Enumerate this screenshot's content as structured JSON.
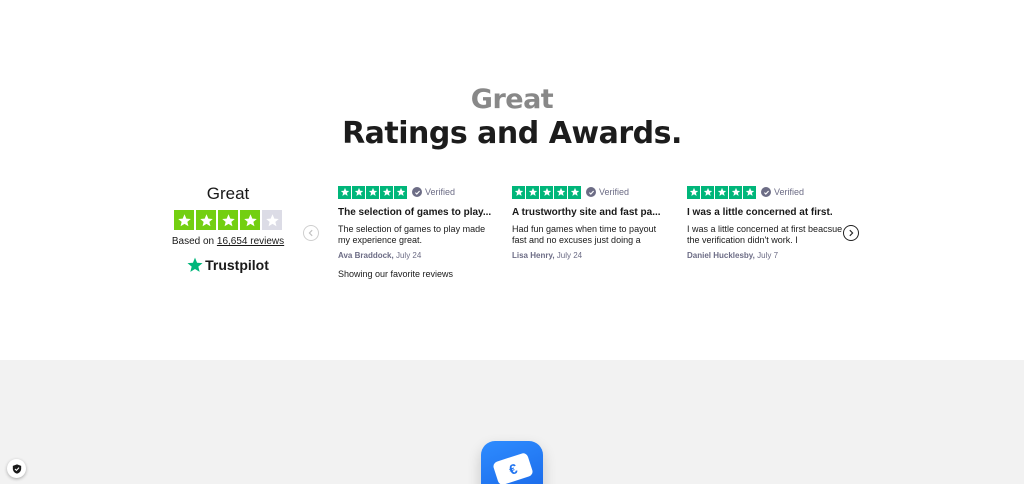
{
  "heading": {
    "sub": "Great",
    "main": "Ratings and Awards."
  },
  "trustpilot": {
    "rating_word": "Great",
    "stars_filled": 4,
    "stars_total": 5,
    "based_on_prefix": "Based on",
    "reviews_link": "16,654 reviews",
    "brand": "Trustpilot",
    "star_color": "#73cf11",
    "logo_star_color": "#00b67a"
  },
  "reviews": [
    {
      "verified_label": "Verified",
      "title": "The selection of games to play...",
      "body": "The selection of games to play made my experience great.",
      "author": "Ava Braddock,",
      "date": "July 24"
    },
    {
      "verified_label": "Verified",
      "title": "A trustworthy site and fast pa...",
      "body": "Had fun games when time to payout fast and no excuses just doing a",
      "author": "Lisa Henry,",
      "date": "July 24"
    },
    {
      "verified_label": "Verified",
      "title": "I was a little concerned at first.",
      "body": "I was a little concerned at first beacsue the verification didn't work. I",
      "author": "Daniel Hucklesby,",
      "date": "July 7"
    }
  ],
  "showing_text": "Showing our favorite reviews",
  "icons": {
    "prev": "chevron-left-icon",
    "next": "chevron-right-icon",
    "verified": "check-circle-icon",
    "shield": "shield-icon",
    "app": "wallet-card-icon"
  },
  "colors": {
    "review_star": "#00b67a",
    "bottom_bg": "#f2f2f2",
    "app_icon": "#1f73f0"
  }
}
